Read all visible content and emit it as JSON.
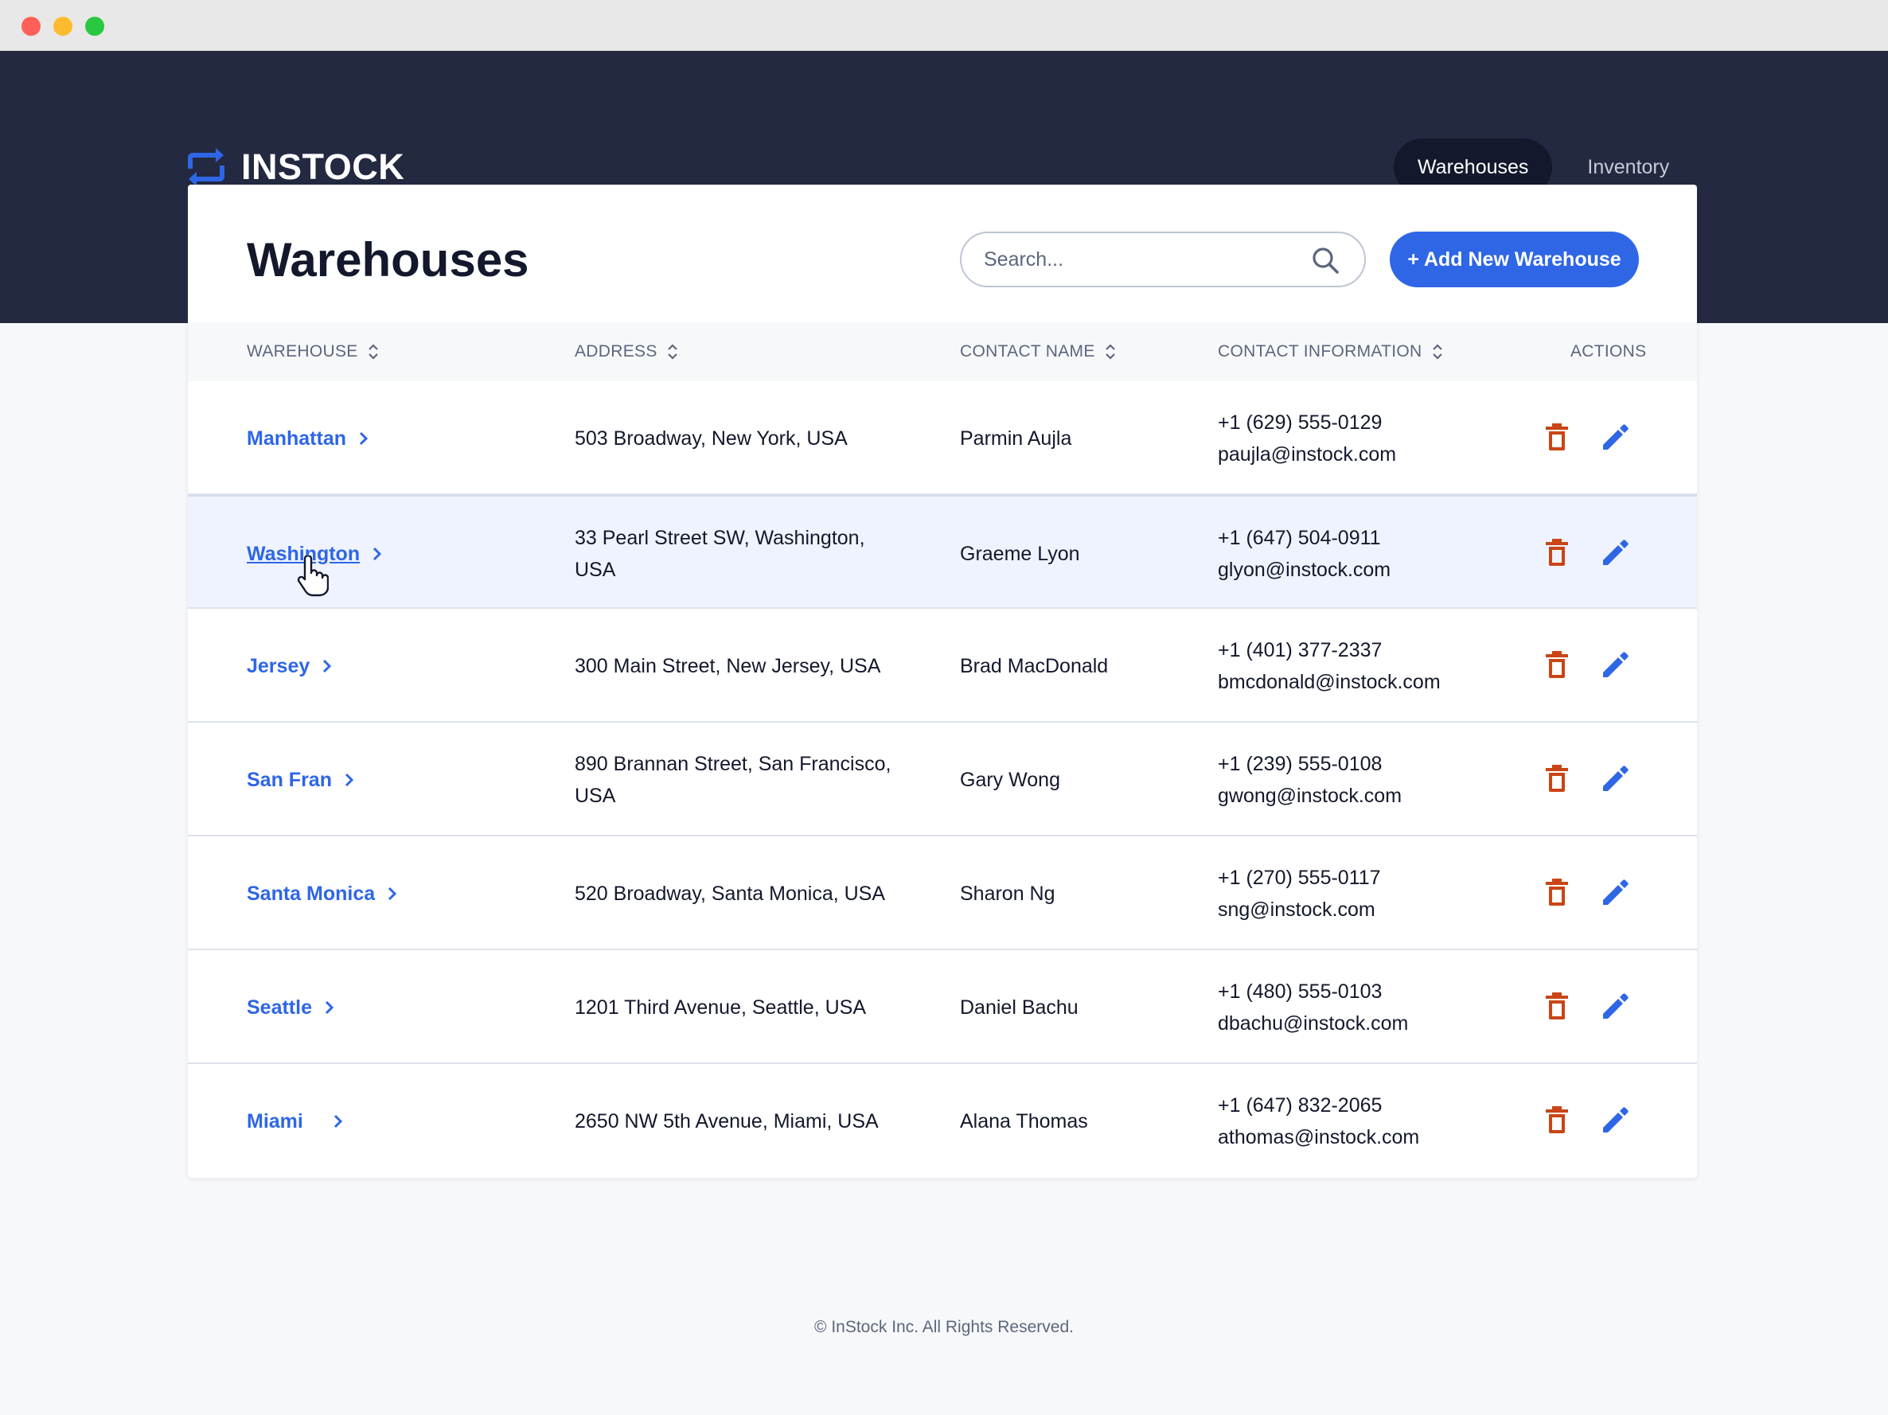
{
  "app": {
    "name": "INSTOCK"
  },
  "nav": {
    "items": [
      {
        "label": "Warehouses",
        "active": true
      },
      {
        "label": "Inventory",
        "active": false
      }
    ]
  },
  "page": {
    "title": "Warehouses"
  },
  "search": {
    "placeholder": "Search..."
  },
  "add_button": {
    "label": "+ Add New Warehouse"
  },
  "table": {
    "columns": [
      "WAREHOUSE",
      "ADDRESS",
      "CONTACT NAME",
      "CONTACT INFORMATION",
      "ACTIONS"
    ],
    "rows": [
      {
        "warehouse": "Manhattan",
        "address": "503 Broadway, New York, USA",
        "contact": "Parmin Aujla",
        "phone": "+1 (629) 555-0129",
        "email": "paujla@instock.com"
      },
      {
        "warehouse": "Washington",
        "address": "33 Pearl Street SW, Washington, USA",
        "contact": "Graeme Lyon",
        "phone": "+1 (647) 504-0911",
        "email": "glyon@instock.com"
      },
      {
        "warehouse": "Jersey",
        "address": "300 Main Street, New Jersey, USA",
        "contact": "Brad MacDonald",
        "phone": "+1 (401) 377-2337",
        "email": "bmcdonald@instock.com"
      },
      {
        "warehouse": "San Fran",
        "address": "890 Brannan Street, San Francisco, USA",
        "contact": "Gary Wong",
        "phone": "+1 (239) 555-0108",
        "email": "gwong@instock.com"
      },
      {
        "warehouse": "Santa Monica",
        "address": "520 Broadway, Santa Monica, USA",
        "contact": "Sharon Ng",
        "phone": "+1 (270) 555-0117",
        "email": "sng@instock.com"
      },
      {
        "warehouse": "Seattle",
        "address": "1201 Third Avenue, Seattle, USA",
        "contact": "Daniel Bachu",
        "phone": "+1 (480) 555-0103",
        "email": "dbachu@instock.com"
      },
      {
        "warehouse": "Miami",
        "address": "2650 NW 5th Avenue, Miami, USA",
        "contact": "Alana Thomas",
        "phone": "+1 (647) 832-2065",
        "email": "athomas@instock.com"
      }
    ]
  },
  "footer": {
    "text": "© InStock Inc. All Rights Reserved."
  },
  "colors": {
    "header_bg": "#232940",
    "accent": "#2e66e6",
    "delete": "#c94515",
    "text_dark": "#13182c"
  }
}
